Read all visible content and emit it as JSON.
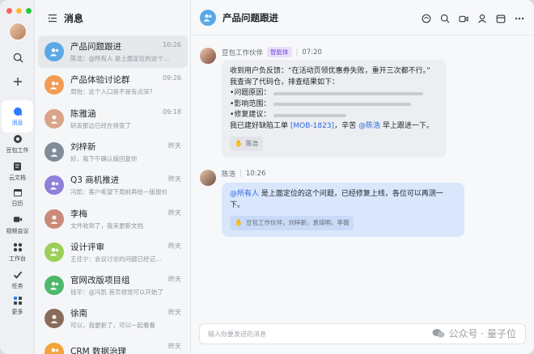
{
  "sidebar": {
    "items": [
      {
        "label": "消息",
        "icon": "message-icon"
      },
      {
        "label": "豆包工作",
        "icon": "doubao-icon"
      },
      {
        "label": "云文档",
        "icon": "document-icon"
      },
      {
        "label": "日历",
        "icon": "calendar-icon"
      },
      {
        "label": "视频会议",
        "icon": "video-icon"
      },
      {
        "label": "工作台",
        "icon": "apps-icon"
      },
      {
        "label": "任务",
        "icon": "task-icon"
      },
      {
        "label": "更多",
        "icon": "more-icon"
      }
    ]
  },
  "chat_list": {
    "title": "消息",
    "items": [
      {
        "name": "产品问题跟进",
        "preview": "陈浩：@所有人 是上面定位的这个问题…",
        "time": "10:26",
        "avatar_color": "#5aa8e6",
        "kind": "group"
      },
      {
        "name": "产品体验讨论群",
        "preview": "周怡：这个入口是不是有点深?",
        "time": "09:26",
        "avatar_color": "#f29b54",
        "kind": "group"
      },
      {
        "name": "陈雅涵",
        "preview": "研发那边已经在排查了",
        "time": "09:18",
        "avatar_color": "#d9a48a",
        "kind": "person"
      },
      {
        "name": "刘梓新",
        "preview": "好，我下午确认版回复你",
        "time": "昨天",
        "avatar_color": "#7f8c99",
        "kind": "person"
      },
      {
        "name": "Q3 商机推进",
        "preview": "冯凯：客户希望下周前再给一版报价",
        "time": "昨天",
        "avatar_color": "#8e7fd8",
        "kind": "group"
      },
      {
        "name": "李梅",
        "preview": "文件收到了，我来更新文档",
        "time": "昨天",
        "avatar_color": "#c98a7a",
        "kind": "person"
      },
      {
        "name": "设计评审",
        "preview": "王佳宁：会议讨论的问题已经记…",
        "time": "昨天",
        "avatar_color": "#9ccf5a",
        "kind": "group"
      },
      {
        "name": "官网改版项目组",
        "preview": "钱宇：@冯凯 首页视觉可以开始了",
        "time": "昨天",
        "avatar_color": "#4cb86a",
        "kind": "group"
      },
      {
        "name": "徐南",
        "preview": "可以，我更新了，可以一起看看",
        "time": "昨天",
        "avatar_color": "#8a6b5a",
        "kind": "person"
      },
      {
        "name": "CRM 数据治理",
        "preview": "",
        "time": "昨天",
        "avatar_color": "#f2a43a",
        "kind": "group"
      }
    ]
  },
  "chat": {
    "title": "产品问题跟进",
    "messages": [
      {
        "sender": "豆包工作伙伴",
        "tag": "智能体",
        "time": "07:20",
        "lines": [
          "收到用户负反馈：“在活动页领优惠券失败，重开三次都不行。”",
          "我查询了代码仓，排查结果如下："
        ],
        "bullets": [
          "问题原因：",
          "影响范围：",
          "修复建议："
        ],
        "closing_pre": "我已建好缺陷工单 ",
        "ticket": "[MOB-1823]",
        "closing_mid": "，辛苦 ",
        "mention": "@陈浩",
        "closing_post": " 早上跟进一下。",
        "read_by": "陈浩"
      },
      {
        "sender": "陈浩",
        "time": "10:26",
        "mention": "@所有人",
        "text": " 是上面定位的这个问题，已经修复上线，各位可以再测一下。",
        "read_by": "豆包工作伙伴，刘梓新，袁琦明，李薇"
      }
    ]
  },
  "input": {
    "placeholder": "输入你要发送的消息"
  },
  "watermark": "公众号 · 量子位"
}
